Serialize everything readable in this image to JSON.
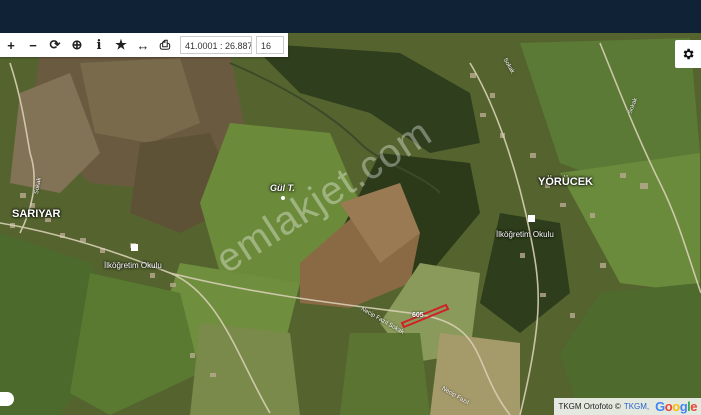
{
  "toolbar": {
    "buttons": [
      {
        "name": "zoom-in-icon",
        "glyph": "+"
      },
      {
        "name": "zoom-out-icon",
        "glyph": "−"
      },
      {
        "name": "refresh-icon",
        "glyph": "⟳"
      },
      {
        "name": "crosshair-icon",
        "glyph": "⊕"
      },
      {
        "name": "info-icon",
        "glyph": "i"
      },
      {
        "name": "star-icon",
        "glyph": "★"
      },
      {
        "name": "measure-icon",
        "glyph": "↔"
      },
      {
        "name": "print-icon",
        "glyph": "⎙"
      }
    ],
    "coordinates": "41.0001 : 26.8874",
    "zoom_level": "16"
  },
  "map": {
    "places": {
      "sariyar": "SARIYAR",
      "yorucek": "YÖRÜCEK",
      "gul_tepe": "Gül T.",
      "school_left": "İlköğretim Okulu",
      "school_right": "İlköğretim Okulu"
    },
    "parcel_label": "605",
    "parcel_color": "#d0202a",
    "watermark": "emlakjet.com",
    "streets": [
      "Sokak",
      "Necip Fazıl Sokak",
      "Necip Fazıl",
      "Sokak",
      "Sokak"
    ]
  },
  "attribution": {
    "prefix": "TKGM Ortofoto ©",
    "link": "TKGM,",
    "google": "Google"
  },
  "colors": {
    "header": "#0f2236",
    "parcel": "#d0202a"
  }
}
